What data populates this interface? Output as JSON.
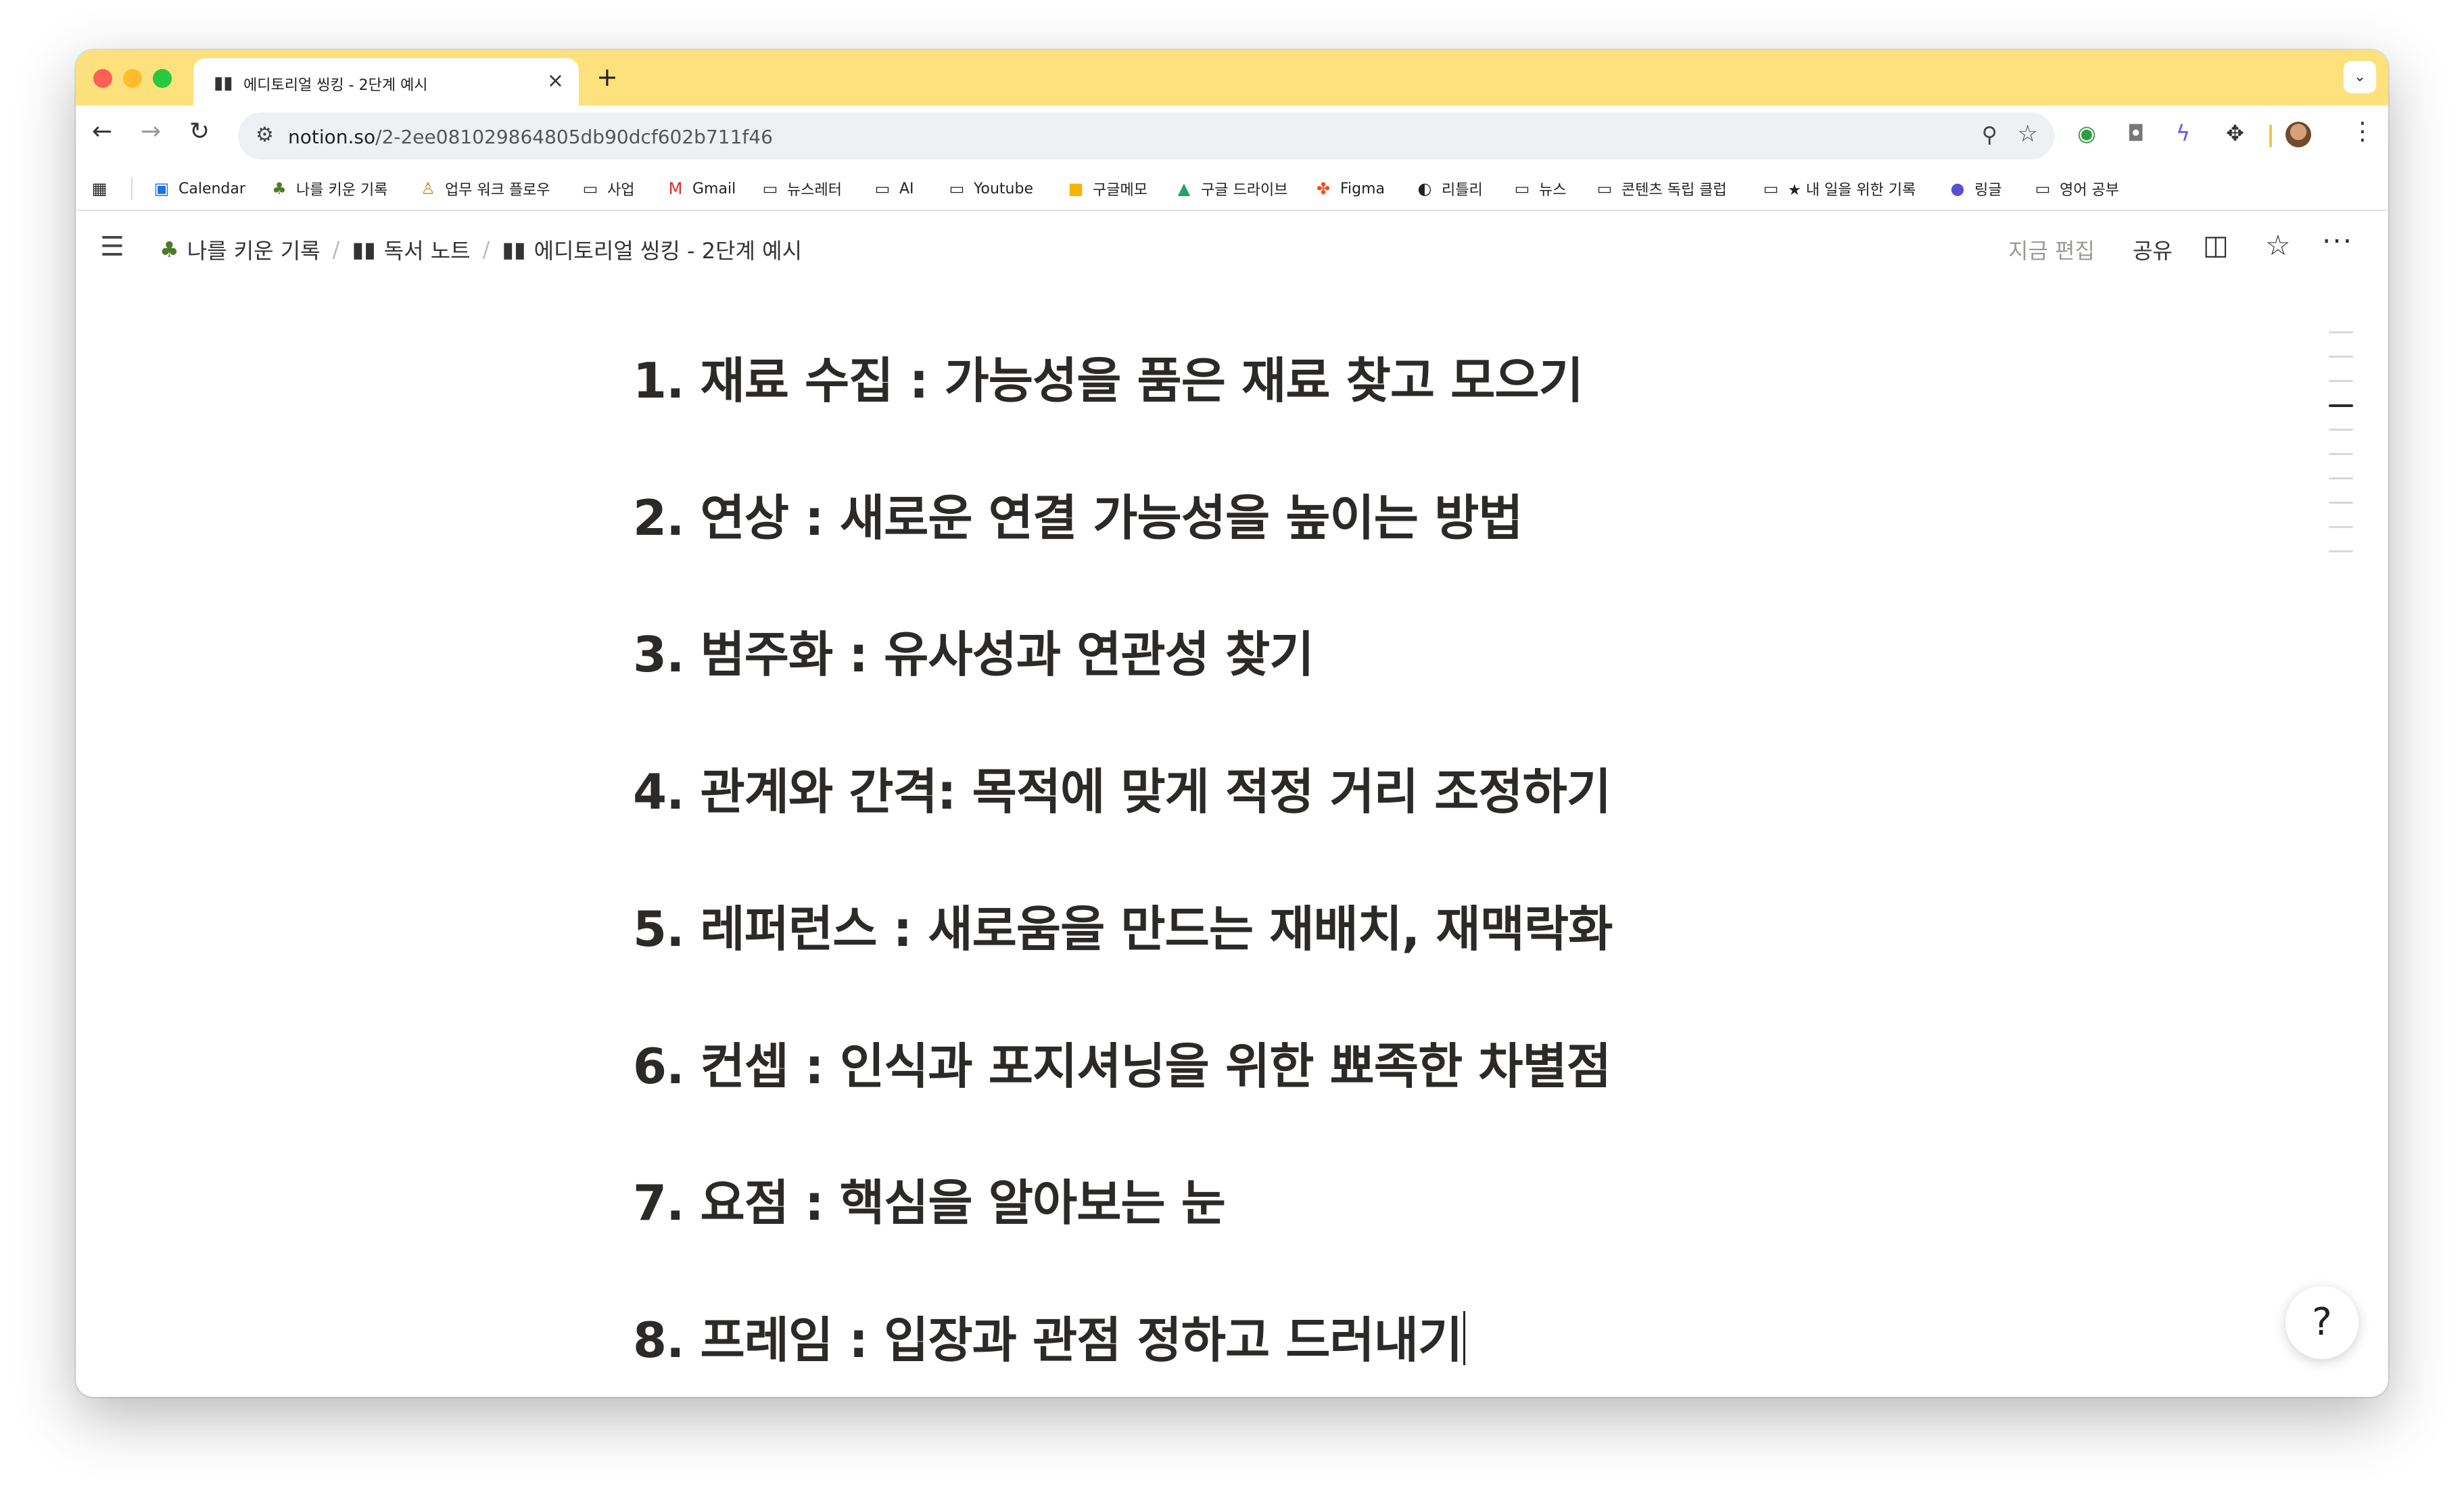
{
  "browser": {
    "tab": {
      "title": "에디토리얼 씽킹 - 2단계 예시",
      "icon": "book-icon"
    },
    "url": {
      "host": "notion.so",
      "path": "/2-2ee081029864805db90dcf602b711f46"
    },
    "bookmarks": [
      {
        "label": "Calendar",
        "icon": "calendar-icon"
      },
      {
        "label": "나를 키운 기록",
        "icon": "tree-icon"
      },
      {
        "label": "업무 워크 플로우",
        "icon": "person-icon"
      },
      {
        "label": "사업",
        "icon": "folder-icon"
      },
      {
        "label": "Gmail",
        "icon": "gmail-icon"
      },
      {
        "label": "뉴스레터",
        "icon": "folder-icon"
      },
      {
        "label": "AI",
        "icon": "folder-icon"
      },
      {
        "label": "Youtube",
        "icon": "folder-icon"
      },
      {
        "label": "구글메모",
        "icon": "keep-icon"
      },
      {
        "label": "구글 드라이브",
        "icon": "drive-icon"
      },
      {
        "label": "Figma",
        "icon": "figma-icon"
      },
      {
        "label": "리틀리",
        "icon": "littly-icon"
      },
      {
        "label": "뉴스",
        "icon": "folder-icon"
      },
      {
        "label": "콘텐츠 독립 클럽",
        "icon": "folder-icon"
      },
      {
        "label": "★ 내 일을 위한 기록",
        "icon": "folder-icon"
      },
      {
        "label": "링글",
        "icon": "ringle-icon"
      },
      {
        "label": "영어 공부",
        "icon": "folder-icon"
      }
    ]
  },
  "notion": {
    "breadcrumbs": [
      {
        "label": "나를 키운 기록",
        "icon": "tree-icon"
      },
      {
        "label": "독서 노트",
        "icon": "book-icon"
      },
      {
        "label": "에디토리얼 씽킹 - 2단계 예시",
        "icon": "book-icon"
      }
    ],
    "edited_label": "지금 편집",
    "share_label": "공유",
    "headings": [
      "1. 재료 수집 : 가능성을 품은 재료 찾고 모으기",
      "2. 연상 : 새로운 연결 가능성을 높이는 방법",
      "3. 범주화 : 유사성과 연관성 찾기",
      "4. 관계와 간격: 목적에 맞게 적정 거리 조정하기",
      "5. 레퍼런스 : 새로움을 만드는 재배치, 재맥락화",
      "6. 컨셉 : 인식과 포지셔닝을 위한 뾰족한 차별점",
      "7. 요점 : 핵심을 알아보는 눈",
      "8. 프레임 : 입장과 관점 정하고 드러내기"
    ],
    "toc": {
      "count": 10,
      "active_index": 3
    }
  },
  "colors": {
    "tabbar": "#fce17c",
    "heading_text": "#2b2a28",
    "muted_text": "#9b9a97"
  }
}
